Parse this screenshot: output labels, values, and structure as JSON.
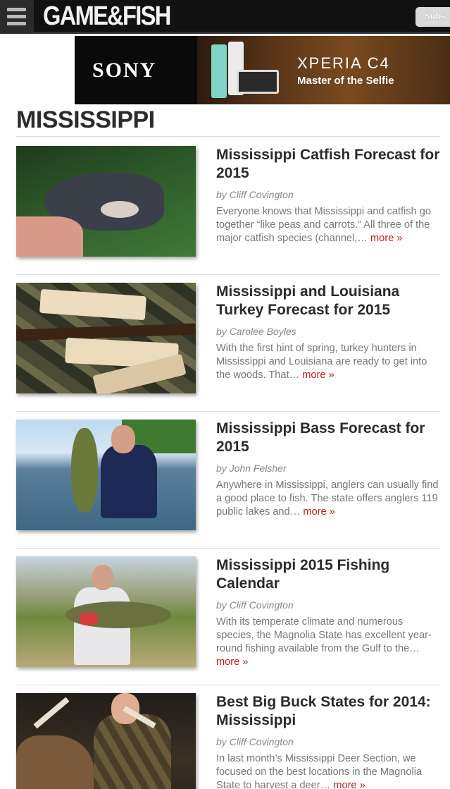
{
  "header": {
    "logo": "GAME&FISH",
    "subscribe_label": "Subs"
  },
  "ad": {
    "brand": "SONY",
    "model": "XPERIA C4",
    "tagline": "Master of the Selfie"
  },
  "section": {
    "title": "MISSISSIPPI"
  },
  "articles": [
    {
      "title": "Mississippi Catfish Forecast for 2015",
      "byline": "by Cliff Covington",
      "excerpt": "Everyone knows that Mississippi and catfish go together “like peas and carrots.” All three of the major catfish species (channel,… ",
      "more": "more »"
    },
    {
      "title": "Mississippi and Louisiana Turkey Forecast for 2015",
      "byline": "by Carolee Boyles",
      "excerpt": "With the first hint of spring, turkey hunters in Mississippi and Louisiana are ready to get into the woods. That… ",
      "more": "more »"
    },
    {
      "title": "Mississippi Bass Forecast for 2015",
      "byline": "by John Felsher",
      "excerpt": "Anywhere in Mississippi, anglers can usually find a good place to fish. The state offers anglers 119 public lakes and… ",
      "more": "more »"
    },
    {
      "title": "Mississippi 2015 Fishing Calendar",
      "byline": "by Cliff Covington",
      "excerpt": "With its temperate climate and numerous species, the Magnolia State has excellent year-round fishing available from the Gulf to the… ",
      "more": "more »"
    },
    {
      "title": "Best Big Buck States for 2014: Mississippi",
      "byline": "by Cliff Covington",
      "excerpt": "In last month’s Mississippi Deer Section, we focused on the best locations in the Magnolia State to harvest a deer… ",
      "more": "more »"
    }
  ]
}
